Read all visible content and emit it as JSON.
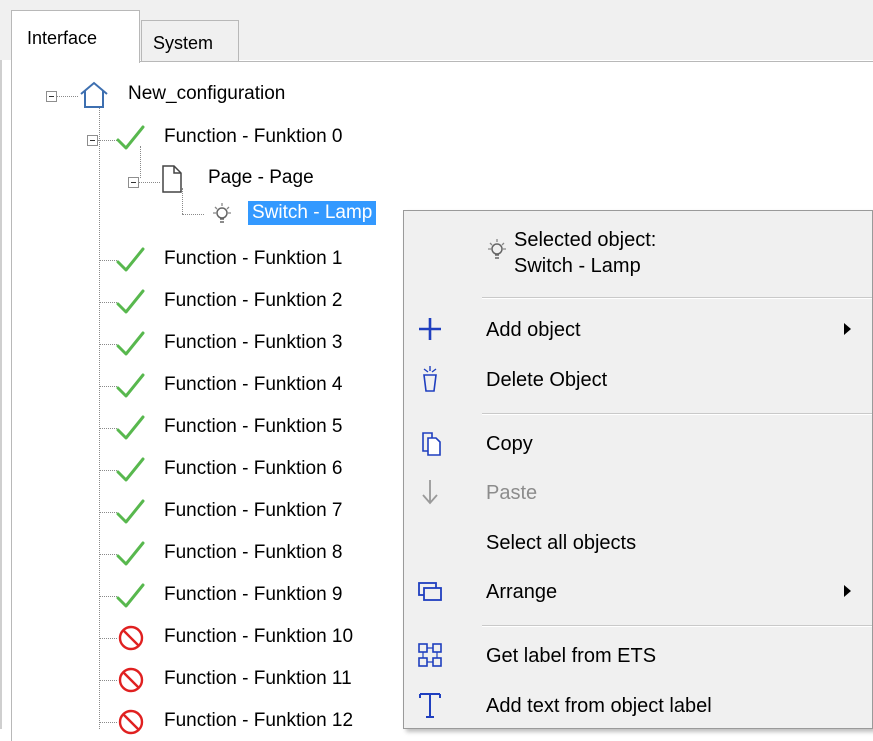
{
  "tabs": {
    "interface": "Interface",
    "system": "System"
  },
  "tree": {
    "root": "New_configuration",
    "function0": "Function - Funktion 0",
    "page": "Page - Page",
    "selected_object": "Switch - Lamp",
    "functions": [
      {
        "label": "Function - Funktion 1",
        "status": "ok"
      },
      {
        "label": "Function - Funktion 2",
        "status": "ok"
      },
      {
        "label": "Function - Funktion 3",
        "status": "ok"
      },
      {
        "label": "Function - Funktion 4",
        "status": "ok"
      },
      {
        "label": "Function - Funktion 5",
        "status": "ok"
      },
      {
        "label": "Function - Funktion 6",
        "status": "ok"
      },
      {
        "label": "Function - Funktion 7",
        "status": "ok"
      },
      {
        "label": "Function - Funktion 8",
        "status": "ok"
      },
      {
        "label": "Function - Funktion 9",
        "status": "ok"
      },
      {
        "label": "Function - Funktion 10",
        "status": "disabled"
      },
      {
        "label": "Function - Funktion 11",
        "status": "disabled"
      },
      {
        "label": "Function - Funktion 12",
        "status": "disabled"
      }
    ]
  },
  "context_menu": {
    "header_title": "Selected object:",
    "header_object": "Switch - Lamp",
    "items": {
      "add_object": "Add object",
      "delete_object": "Delete Object",
      "copy": "Copy",
      "paste": "Paste",
      "select_all": "Select all objects",
      "arrange": "Arrange",
      "get_label": "Get label from ETS",
      "add_text": "Add text from object label"
    }
  },
  "icons": {
    "root": "house-icon",
    "function_ok": "green-check-icon",
    "function_disabled": "red-prohibited-icon",
    "page": "page-icon",
    "object": "lightbulb-icon"
  },
  "colors": {
    "selection": "#3399ff",
    "ok": "#58b84e",
    "disabled": "#e02020",
    "menu_icon": "#1f3fbf"
  }
}
